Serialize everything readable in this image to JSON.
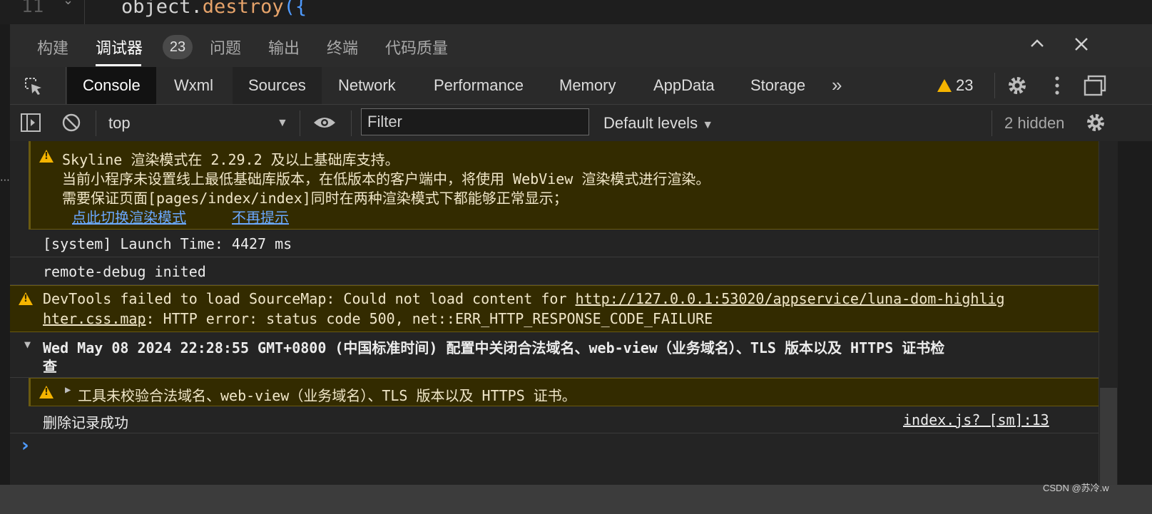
{
  "code": {
    "line_number": "11",
    "prefix": "object.",
    "method": "destroy",
    "suffix": "({"
  },
  "panel_tabs": [
    {
      "label": "构建"
    },
    {
      "label": "调试器"
    },
    {
      "label": "问题"
    },
    {
      "label": "输出"
    },
    {
      "label": "终端"
    },
    {
      "label": "代码质量"
    }
  ],
  "panel_badge": "23",
  "window_controls": {
    "collapse_icon": "chevron-up-icon",
    "close_icon": "close-icon"
  },
  "devtools_tabs": [
    "Console",
    "Wxml",
    "Sources",
    "Network",
    "Performance",
    "Memory",
    "AppData",
    "Storage"
  ],
  "devtools_more": "»",
  "warning_count": "23",
  "toolbar_icons": [
    "gear-icon",
    "kebab-menu-icon",
    "undock-icon"
  ],
  "filter_bar": {
    "context": "top",
    "filter_placeholder": "Filter",
    "levels": "Default levels",
    "hidden": "2 hidden"
  },
  "messages": {
    "skyline": {
      "line1": "Skyline 渲染模式在 2.29.2 及以上基础库支持。",
      "line2": "当前小程序未设置线上最低基础库版本，在低版本的客户端中，将使用 WebView 渲染模式进行渲染。",
      "line3": "需要保证页面[pages/index/index]同时在两种渲染模式下都能够正常显示；",
      "link_switch": "点此切换渲染模式",
      "link_dismiss": "不再提示"
    },
    "launch": "[system] Launch Time: 4427 ms",
    "remote": "remote-debug inited",
    "sourcemap": {
      "prefix": "DevTools failed to load SourceMap: Could not load content for ",
      "url_part1": "http://127.0.0.1:53020/appservice/luna-dom-highlig",
      "url_part2": "hter.css.map",
      "suffix": ": HTTP error: status code 500, net::ERR_HTTP_RESPONSE_CODE_FAILURE"
    },
    "group": {
      "line1": "Wed May 08 2024 22:28:55 GMT+0800 (中国标准时间) 配置中关闭合法域名、web-view（业务域名）、TLS 版本以及 HTTPS 证书检",
      "line2": "查"
    },
    "tls_warning": "工具未校验合法域名、web-view（业务域名）、TLS 版本以及 HTTPS 证书。",
    "delete_ok": "删除记录成功",
    "delete_source": "index.js? [sm]:13"
  },
  "prompt_symbol": "›",
  "watermark": "CSDN @苏冷.w",
  "colors": {
    "warning_bg": "#332b00",
    "warning_icon": "#f5b400",
    "link": "#6aa8ff",
    "accent": "#4f9bff"
  }
}
